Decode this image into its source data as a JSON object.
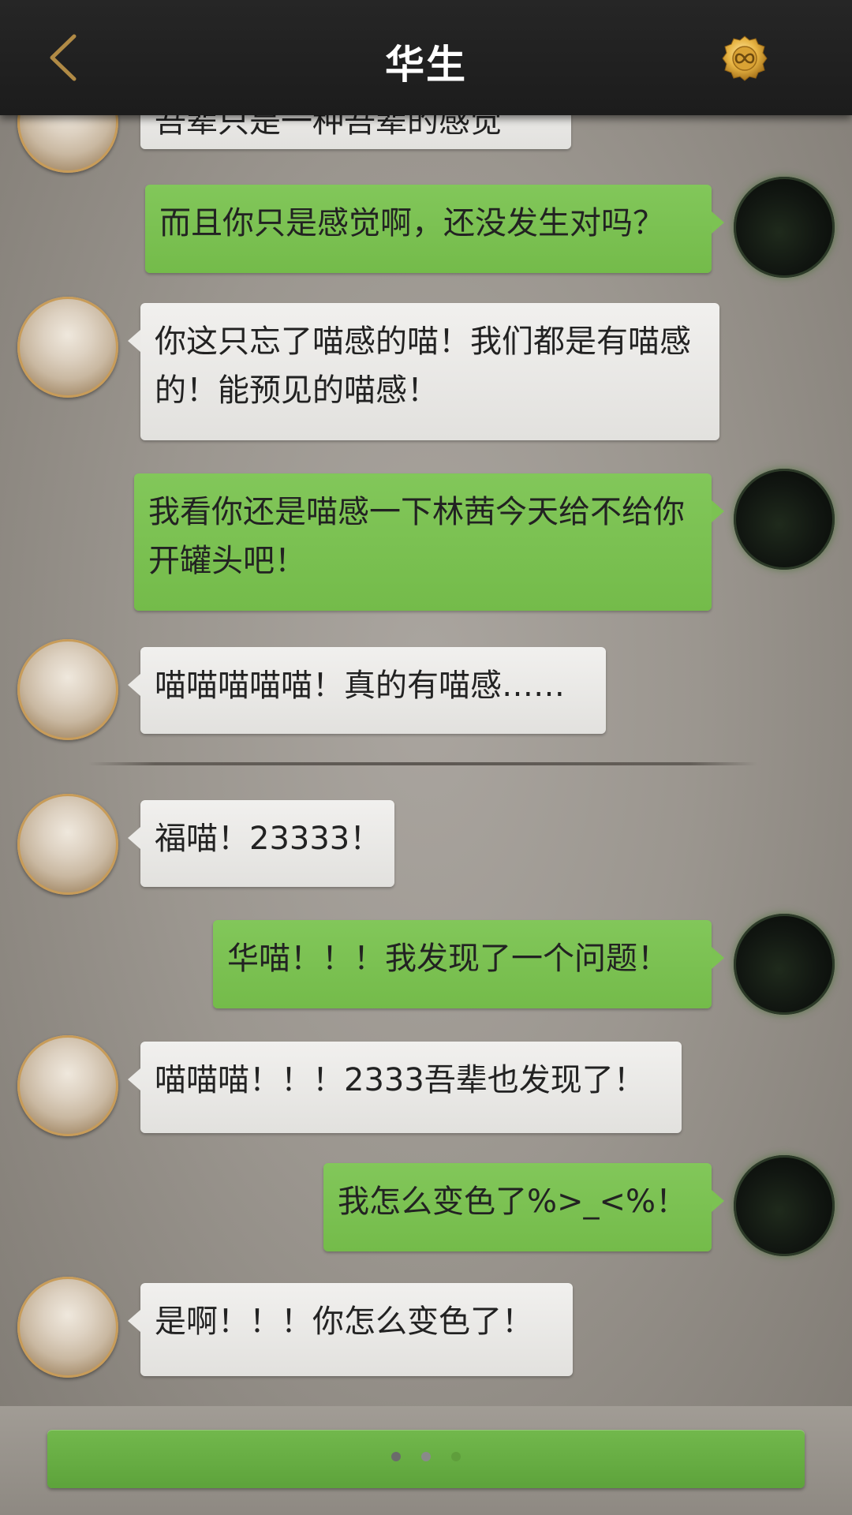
{
  "header": {
    "title": "华生",
    "back_icon": "chevron-left-icon",
    "coin_icon": "infinity-coin-icon",
    "accent_color": "#c9a24a"
  },
  "messages": [
    {
      "side": "left",
      "speaker": "cat",
      "text": "吾辈只是一种吾辈的感觉"
    },
    {
      "side": "right",
      "speaker": "dark",
      "text": "而且你只是感觉啊，还没发生对吗？"
    },
    {
      "side": "left",
      "speaker": "cat",
      "text": "你这只忘了喵感的喵！我们都是有喵感的！能预见的喵感！"
    },
    {
      "side": "right",
      "speaker": "dark",
      "text": "我看你还是喵感一下林茜今天给不给你开罐头吧！"
    },
    {
      "side": "left",
      "speaker": "cat",
      "text": "喵喵喵喵喵！真的有喵感……"
    },
    {
      "side": "left",
      "speaker": "cat",
      "text": "福喵！23333！"
    },
    {
      "side": "right",
      "speaker": "dark",
      "text": "华喵！！！我发现了一个问题！"
    },
    {
      "side": "left",
      "speaker": "cat",
      "text": "喵喵喵！！！2333吾辈也发现了！"
    },
    {
      "side": "right",
      "speaker": "dark",
      "text": "我怎么变色了%>_<%！"
    },
    {
      "side": "left",
      "speaker": "cat",
      "text": "是啊！！！你怎么变色了！"
    }
  ],
  "footer": {
    "continue_button_color": "#6aae44",
    "dots": [
      "#6b6b6b",
      "#8a8a8a",
      "#5f9e3c"
    ]
  }
}
